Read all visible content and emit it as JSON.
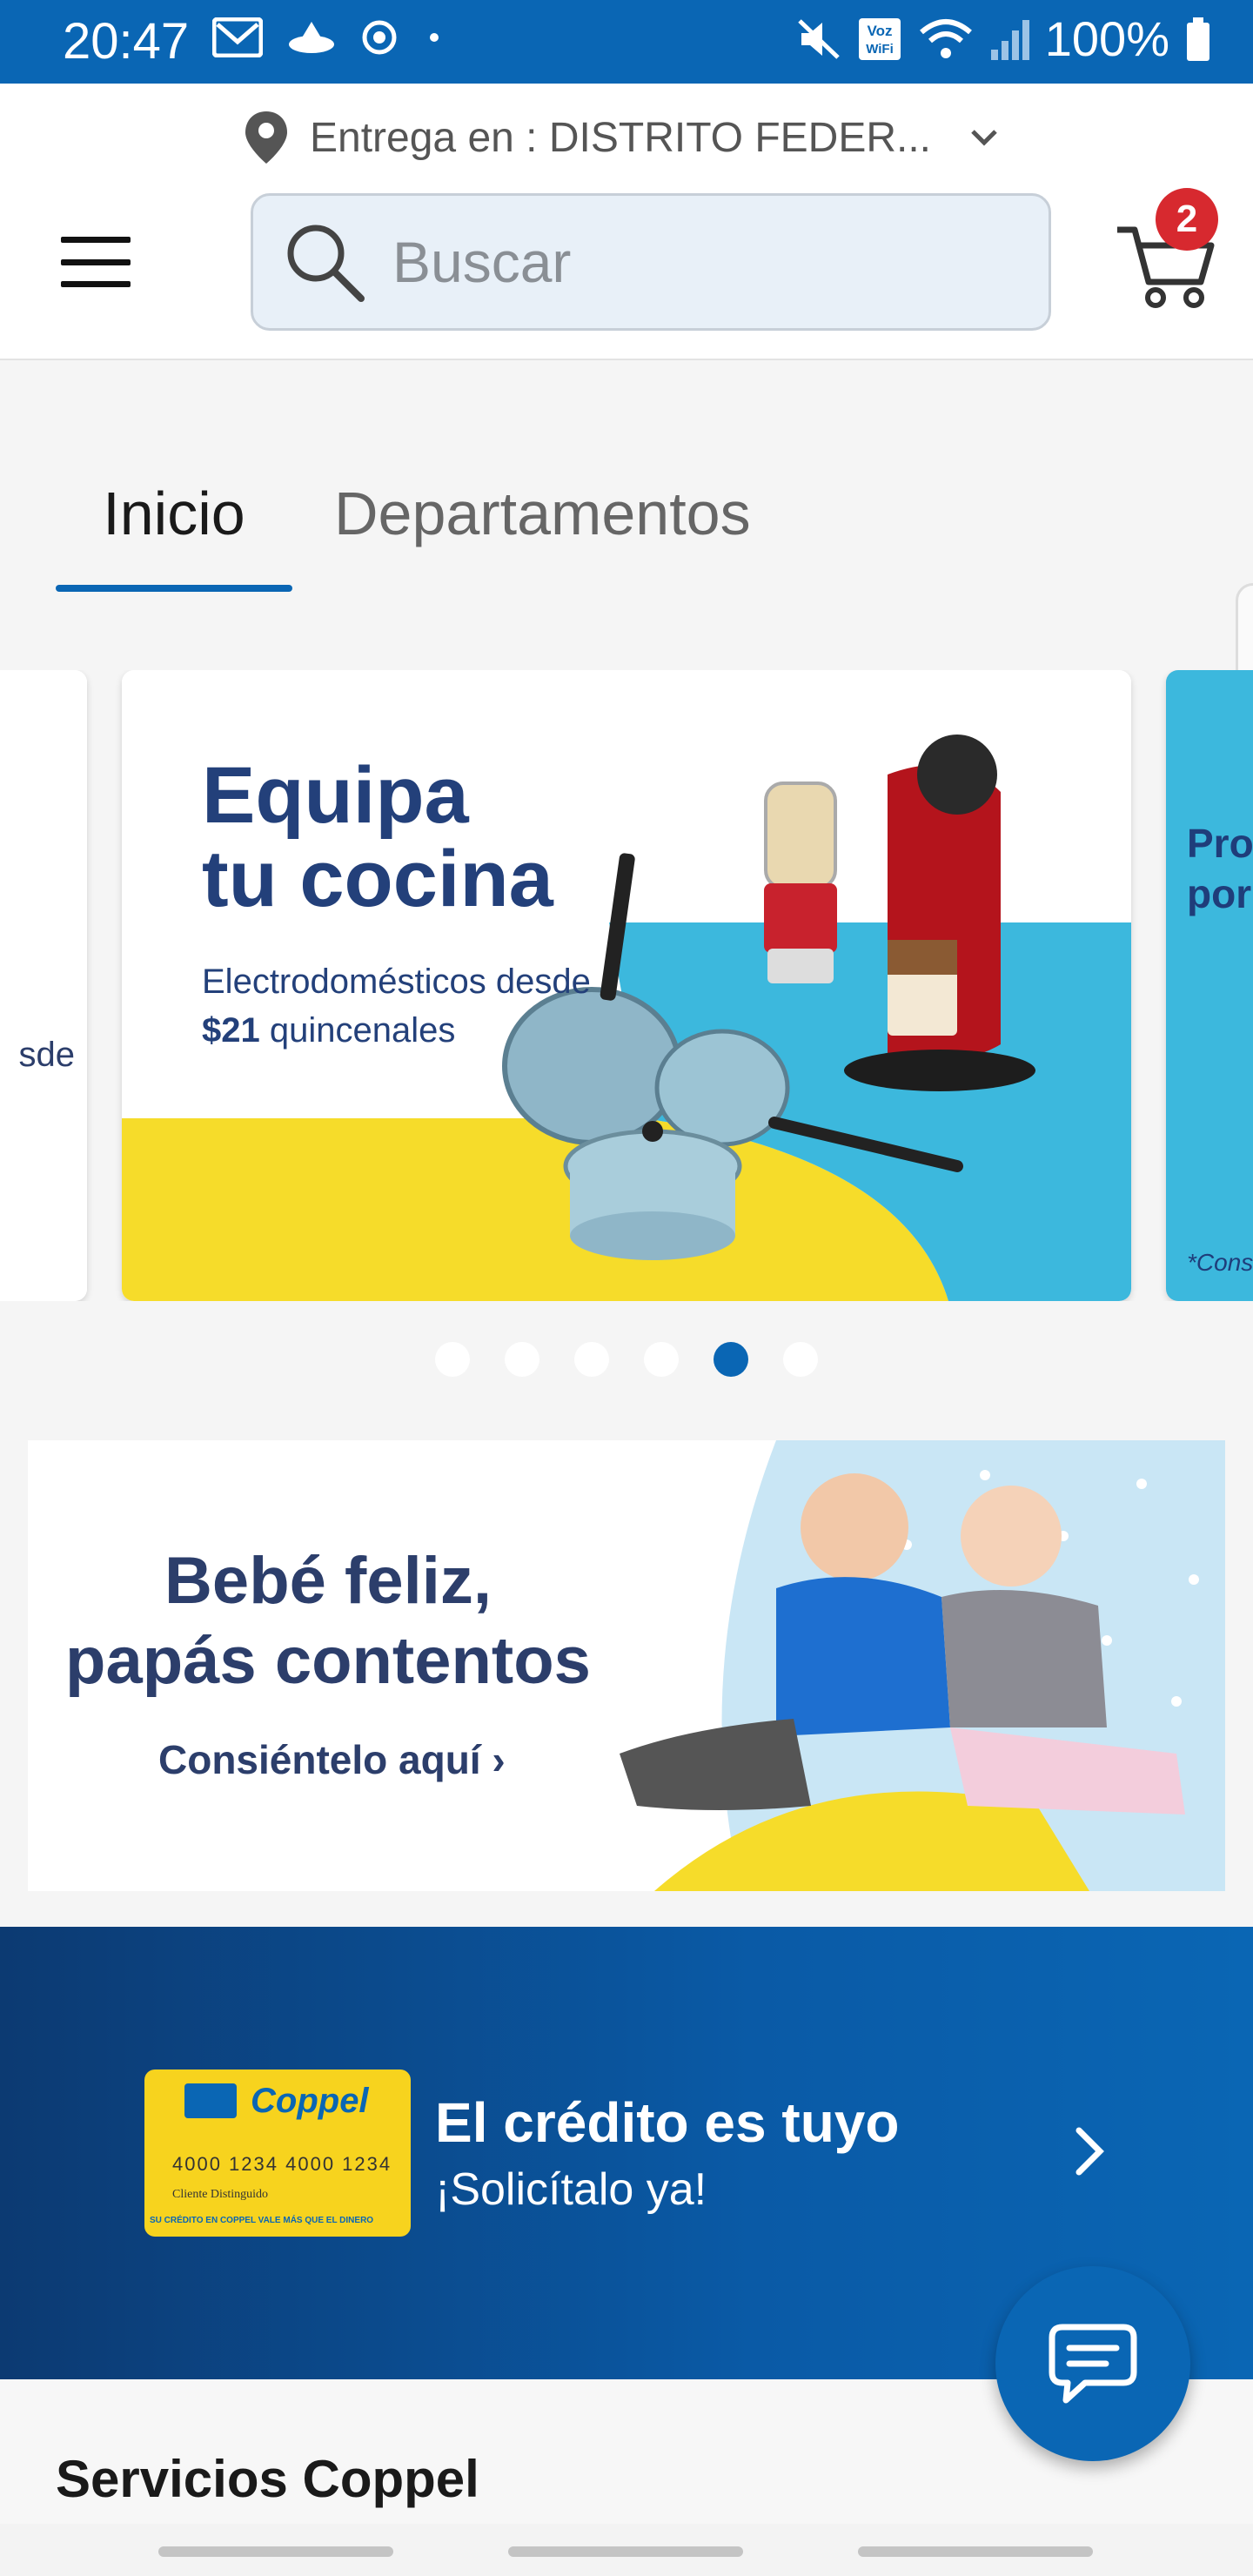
{
  "status_bar": {
    "time": "20:47",
    "battery": "100%",
    "icons": [
      "gmail-icon",
      "bird-icon",
      "gear-icon",
      "dot-icon",
      "mute-icon",
      "volte-icon",
      "wifi-icon",
      "signal-icon",
      "battery-icon"
    ]
  },
  "header": {
    "delivery_label": "Entrega en : DISTRITO FEDER...",
    "search_placeholder": "Buscar",
    "cart_count": "2"
  },
  "tabs": [
    {
      "label": "Inicio",
      "active": true
    },
    {
      "label": "Departamentos",
      "active": false
    }
  ],
  "carousel": {
    "prev_fragment": "sde",
    "main": {
      "title_line1": "Equipa",
      "title_line2": "tu cocina",
      "sub_line1": "Electrodomésticos desde",
      "sub_price": "$21",
      "sub_rest": "quincenales"
    },
    "next_fragment_1": "Pro",
    "next_fragment_2": "por",
    "next_fragment_3": "*Cons",
    "dots": 6,
    "active_dot": 4
  },
  "baby_banner": {
    "title_line1": "Bebé feliz,",
    "title_line2": "papás contentos",
    "cta": "Consiéntelo aquí ›"
  },
  "credit_banner": {
    "title": "El crédito es tuyo",
    "subtitle": "¡Solicítalo ya!",
    "card_brand": "Coppel",
    "card_number": "4000 1234 4000 1234",
    "card_holder": "Cliente Distinguido",
    "card_fine_print": "SU CRÉDITO EN COPPEL VALE MÁS QUE EL DINERO"
  },
  "services": {
    "title": "Servicios Coppel"
  },
  "colors": {
    "brand_blue": "#0a66b4",
    "badge_red": "#d7292f",
    "dark_navy": "#23407a",
    "banner_yellow": "#f6dc2a",
    "banner_cyan": "#3cb8dd"
  }
}
